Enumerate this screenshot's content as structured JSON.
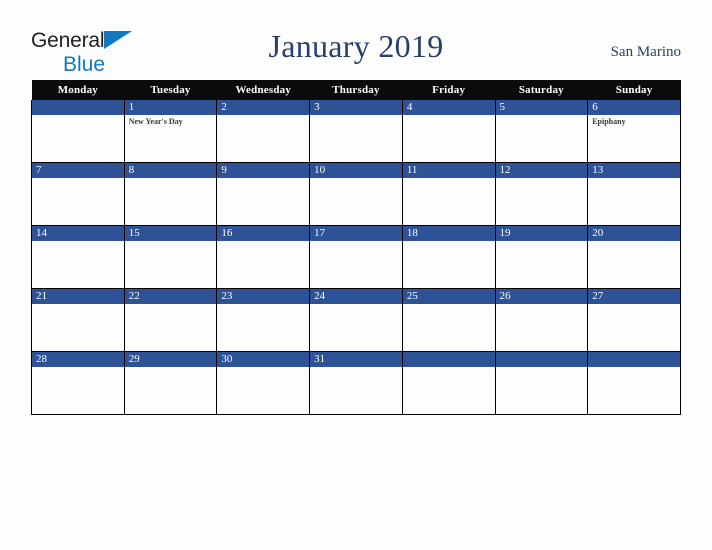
{
  "brand": {
    "line1": "General",
    "line2": "Blue",
    "accent_color": "#1278be",
    "text_color": "#231f20"
  },
  "header": {
    "title": "January 2019",
    "location": "San Marino",
    "title_color": "#27406b"
  },
  "calendar": {
    "weekday_headers": [
      "Monday",
      "Tuesday",
      "Wednesday",
      "Thursday",
      "Friday",
      "Saturday",
      "Sunday"
    ],
    "header_bg": "#0b0b0b",
    "daynum_bg": "#2d5295",
    "weeks": [
      [
        {
          "day": "",
          "events": []
        },
        {
          "day": "1",
          "events": [
            "New Year's Day"
          ]
        },
        {
          "day": "2",
          "events": []
        },
        {
          "day": "3",
          "events": []
        },
        {
          "day": "4",
          "events": []
        },
        {
          "day": "5",
          "events": []
        },
        {
          "day": "6",
          "events": [
            "Epiphany"
          ]
        }
      ],
      [
        {
          "day": "7",
          "events": []
        },
        {
          "day": "8",
          "events": []
        },
        {
          "day": "9",
          "events": []
        },
        {
          "day": "10",
          "events": []
        },
        {
          "day": "11",
          "events": []
        },
        {
          "day": "12",
          "events": []
        },
        {
          "day": "13",
          "events": []
        }
      ],
      [
        {
          "day": "14",
          "events": []
        },
        {
          "day": "15",
          "events": []
        },
        {
          "day": "16",
          "events": []
        },
        {
          "day": "17",
          "events": []
        },
        {
          "day": "18",
          "events": []
        },
        {
          "day": "19",
          "events": []
        },
        {
          "day": "20",
          "events": []
        }
      ],
      [
        {
          "day": "21",
          "events": []
        },
        {
          "day": "22",
          "events": []
        },
        {
          "day": "23",
          "events": []
        },
        {
          "day": "24",
          "events": []
        },
        {
          "day": "25",
          "events": []
        },
        {
          "day": "26",
          "events": []
        },
        {
          "day": "27",
          "events": []
        }
      ],
      [
        {
          "day": "28",
          "events": []
        },
        {
          "day": "29",
          "events": []
        },
        {
          "day": "30",
          "events": []
        },
        {
          "day": "31",
          "events": []
        },
        {
          "day": "",
          "events": []
        },
        {
          "day": "",
          "events": []
        },
        {
          "day": "",
          "events": []
        }
      ]
    ]
  }
}
